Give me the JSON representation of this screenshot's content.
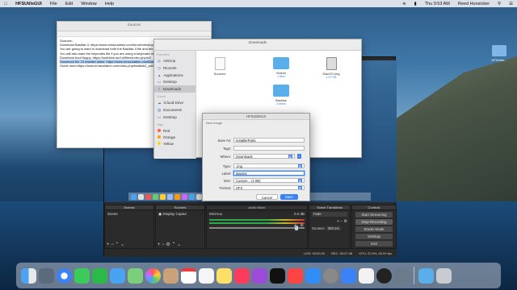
{
  "menubar": {
    "app_name": "HFSUtilsGUI",
    "items": [
      "File",
      "Edit",
      "Window",
      "Help"
    ],
    "clock": "Thu 9:53 AM",
    "user": "Reed Hunsicker"
  },
  "desktop_icon": {
    "label": "HFSUtils..."
  },
  "textedit": {
    "title": "Sources",
    "lines": [
      "Sources:",
      "Download Basilisk II: https://www.emaculation.com/forum/viewtopic",
      "You are going to want to download both the Basilisk II file and the",
      "You will also want the keycodes file if you are using a keyboard ot",
      "Download boot floppy: https://surfdrive.surf.nl/files/index.php/s/2",
      "Download the 19 installer disks: https://www.emaculation.com/basilisk",
      "Guide used:https://www.emaculation.com/doku.php/basilisk2_sdl2_..."
    ]
  },
  "finder": {
    "title": "Downloads",
    "sidebar_sections": [
      {
        "header": "Favorites",
        "items": [
          "AirDrop",
          "Recents",
          "Applications",
          "Desktop",
          "Downloads"
        ]
      },
      {
        "header": "iCloud",
        "items": [
          "iCloud Drive",
          "Documents",
          "Desktop"
        ]
      },
      {
        "header": "Tags",
        "items": [
          "Red",
          "Orange",
          "Yellow"
        ]
      }
    ],
    "selected_item": "Downloads",
    "files": [
      {
        "name": "Sources",
        "sub": "",
        "kind": "doc"
      },
      {
        "name": "Videos",
        "sub": "1 item",
        "kind": "folder"
      },
      {
        "name": "Basilisk",
        "sub": "4 items",
        "kind": "folder"
      },
      {
        "name": "MacOS.img",
        "sub": "1.07 GB",
        "kind": "disk"
      }
    ]
  },
  "dialog": {
    "window_title": "HFSUtilsGUI",
    "subtitle": "New Image",
    "save_as_label": "Save As:",
    "save_as_value": "InstallerParts",
    "tags_label": "Tags:",
    "where_label": "Where:",
    "where_value": "Downloads",
    "type_label": "Type:",
    "type_value": ".img",
    "label_label": "Label:",
    "label_value": "MacIns",
    "size_label": "Size:",
    "size_value": "Custom... (1.0B)",
    "format_label": "Format:",
    "format_value": "HFS",
    "cancel": "Cancel",
    "save": "Save"
  },
  "obs": {
    "scenes_header": "Scenes",
    "scenes": [
      "Scene"
    ],
    "sources_header": "Sources",
    "sources": [
      "Display Captur"
    ],
    "mixer_header": "Audio Mixer",
    "mixer_track": "Mic/Aux",
    "mixer_db": "0.0 dB",
    "transitions_header": "Scene Transitions",
    "transition_value": "Fade",
    "duration_label": "Duration",
    "duration_value": "300 ms",
    "controls_header": "Controls",
    "controls": [
      "Start Streaming",
      "Stop Recording",
      "Studio Mode",
      "Settings",
      "Exit"
    ],
    "status": [
      "LIVE: 00:00:00",
      "REC: 00:07:48",
      "CPU: 22.9%, 60.00 fps"
    ]
  },
  "colors": {
    "accent": "#3b82f6",
    "obs_bg": "#2a2a2a",
    "tag_red": "#ff5f57",
    "tag_orange": "#ff9f0a",
    "tag_yellow": "#ffd60a"
  }
}
